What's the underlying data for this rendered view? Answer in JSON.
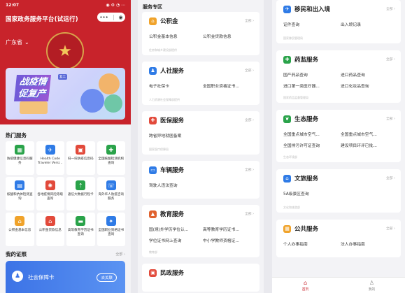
{
  "status_bar": {
    "time": "12:07",
    "icons": "◉ ⚙ ◔ ⋯"
  },
  "app": {
    "title": "国家政务服务平台(试运行)",
    "region": "广东省"
  },
  "banner": {
    "line1": "战疫情",
    "line2": "促复产",
    "tag": "复工"
  },
  "hot_services": {
    "title": "热门服务",
    "items": [
      {
        "label": "防疫健康信息码服务",
        "icon": "qr-grid-icon",
        "color": "#2aa34a",
        "glyph": "▦"
      },
      {
        "label": "Health Code Traveler Versi...",
        "icon": "plane-icon",
        "color": "#2f7be6",
        "glyph": "✈"
      },
      {
        "label": "扫一扫防疫信息码",
        "icon": "scan-icon",
        "color": "#e24a3b",
        "glyph": "▣"
      },
      {
        "label": "全国核酸检测机构查询",
        "icon": "hospital-icon",
        "color": "#2aa34a",
        "glyph": "✚"
      },
      {
        "label": "核酸和抗体检测查询",
        "icon": "report-icon",
        "color": "#2f7be6",
        "glyph": "▤"
      },
      {
        "label": "各地疫情风险等级查询",
        "icon": "virus-icon",
        "color": "#e24a3b",
        "glyph": "✺"
      },
      {
        "label": "通信大数据行程卡",
        "icon": "trip-arrow-icon",
        "color": "#2aa34a",
        "glyph": "⇡"
      },
      {
        "label": "海外华人防疫咨询服务",
        "icon": "support-icon",
        "color": "#2f7be6",
        "glyph": "☏"
      },
      {
        "label": "公积金基本信息",
        "icon": "house-icon",
        "color": "#f0a32b",
        "glyph": "⌂"
      },
      {
        "label": "公积金贷款信息",
        "icon": "house-loan-icon",
        "color": "#e24a3b",
        "glyph": "⌂"
      },
      {
        "label": "高等教育学历证书查询",
        "icon": "certificate-icon",
        "color": "#2aa34a",
        "glyph": "▬"
      },
      {
        "label": "全国职业资格证书查询",
        "icon": "badge-icon",
        "color": "#2f7be6",
        "glyph": "✦"
      }
    ]
  },
  "my_certs": {
    "title": "我的证照",
    "all_label": "全部 ›",
    "card_name": "社会保障卡",
    "card_action": "去关联"
  },
  "service_zone": {
    "title": "服务专区",
    "cards": [
      {
        "title": "公积金",
        "icon": "house-icon",
        "color": "#f0a32b",
        "glyph": "⌂",
        "all": "全部 ›",
        "items": [
          "公积金基本信息",
          "公积金贷款信息"
        ],
        "source": "住房和城乡建设部提供"
      },
      {
        "title": "人社服务",
        "icon": "person-icon",
        "color": "#2f7be6",
        "glyph": "♟",
        "all": "全部 ›",
        "items": [
          "电子社保卡",
          "全国职业资格证书..."
        ],
        "source": "人力资源社会保障部提供"
      },
      {
        "title": "医保服务",
        "icon": "medical-icon",
        "color": "#e24a3b",
        "glyph": "✚",
        "all": "全部 ›",
        "items": [
          "跨省异地就医备案"
        ],
        "source": "国家医疗保障局"
      },
      {
        "title": "车辆服务",
        "icon": "car-icon",
        "color": "#2f7be6",
        "glyph": "▭",
        "all": "全部 ›",
        "items": [
          "驾驶人违法查询"
        ],
        "source": ""
      },
      {
        "title": "教育服务",
        "icon": "graduation-cap-icon",
        "color": "#e0612e",
        "glyph": "▲",
        "all": "全部 ›",
        "items": [
          "国(境)外学历学位认...",
          "高等教育学历证书...",
          "学位证书网上查询",
          "中小学教师资格证..."
        ],
        "source": "教育部"
      },
      {
        "title": "民政服务",
        "icon": "civil-affairs-icon",
        "color": "#e24a3b",
        "glyph": "▣",
        "all": "",
        "items": [],
        "source": ""
      }
    ]
  },
  "right_cards": [
    {
      "title": "移民和出入境",
      "icon": "immigration-icon",
      "color": "#2f7be6",
      "glyph": "✈",
      "all": "全部 ›",
      "items": [
        "证件查询",
        "出入境记录"
      ],
      "source": "国家移民管理局"
    },
    {
      "title": "药监服务",
      "icon": "medicine-icon",
      "color": "#2aa34a",
      "glyph": "✚",
      "all": "全部 ›",
      "items": [
        "国产药品查询",
        "进口药品查询",
        "进口第一类医疗器...",
        "进口化妆品查询"
      ],
      "source": "国家药品监督管理局"
    },
    {
      "title": "生态服务",
      "icon": "leaf-icon",
      "color": "#2aa34a",
      "glyph": "❦",
      "all": "全部 ›",
      "items": [
        "全国重点城市空气...",
        "全国重点城市空气...",
        "全国排污许可证查询",
        "建设项目环评已批..."
      ],
      "source": "生态环境部"
    },
    {
      "title": "文旅服务",
      "icon": "museum-icon",
      "color": "#2f7be6",
      "glyph": "⌂",
      "all": "全部 ›",
      "items": [
        "5A级景区查询"
      ],
      "source": "文化和旅游部"
    },
    {
      "title": "公共服务",
      "icon": "grid-icon",
      "color": "#f0a32b",
      "glyph": "▦",
      "all": "全部 ›",
      "items": [
        "个人办事指南",
        "法人办事指南"
      ],
      "source": ""
    }
  ],
  "tabbar": {
    "home": "首页",
    "mine": "我的"
  }
}
